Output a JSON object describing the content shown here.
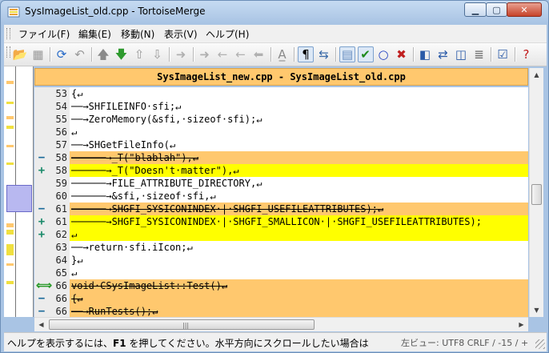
{
  "window": {
    "title": "SysImageList_old.cpp - TortoiseMerge"
  },
  "menu": [
    "ファイル(F)",
    "編集(E)",
    "移動(N)",
    "表示(V)",
    "ヘルプ(H)"
  ],
  "toolbar": [
    {
      "name": "open-icon",
      "glyph": "📂",
      "color": "#d9a21f",
      "pressed": false
    },
    {
      "name": "save-icon",
      "glyph": "▦",
      "color": "#9a9a9a",
      "pressed": false
    },
    {
      "name": "sep"
    },
    {
      "name": "reload-icon",
      "glyph": "⟳",
      "color": "#2a6cc8",
      "pressed": false
    },
    {
      "name": "undo-icon",
      "glyph": "↶",
      "color": "#9a9a9a",
      "pressed": false
    },
    {
      "name": "sep"
    },
    {
      "name": "prev-difference-icon",
      "glyph": "🡅",
      "color": "#8a8a8a",
      "pressed": false
    },
    {
      "name": "next-difference-icon",
      "glyph": "🡇",
      "color": "#2e9a2e",
      "pressed": false
    },
    {
      "name": "prev-conflict-icon",
      "glyph": "⇧",
      "color": "#9a9a9a",
      "pressed": false
    },
    {
      "name": "next-conflict-icon",
      "glyph": "⇩",
      "color": "#9a9a9a",
      "pressed": false
    },
    {
      "name": "sep"
    },
    {
      "name": "use-left-icon",
      "glyph": "➜",
      "color": "#b0b0b0",
      "pressed": false
    },
    {
      "name": "sep"
    },
    {
      "name": "use-block-right-icon",
      "glyph": "➜",
      "color": "#b0b0b0",
      "pressed": false
    },
    {
      "name": "use-block-left-icon",
      "glyph": "←",
      "color": "#b0b0b0",
      "pressed": false
    },
    {
      "name": "use-both-icon",
      "glyph": "←",
      "color": "#b0b0b0",
      "pressed": false
    },
    {
      "name": "use-both-left-icon",
      "glyph": "⬅",
      "color": "#b0b0b0",
      "pressed": false
    },
    {
      "name": "sep"
    },
    {
      "name": "whitespace-icon",
      "glyph": "A̲",
      "color": "#8a8a8a",
      "pressed": false
    },
    {
      "name": "sep"
    },
    {
      "name": "pilcrow-icon",
      "glyph": "¶",
      "color": "#000000",
      "pressed": true
    },
    {
      "name": "wrap-icon",
      "glyph": "⇆",
      "color": "#3a6aa8",
      "pressed": false
    },
    {
      "name": "sep"
    },
    {
      "name": "one-pane-icon",
      "glyph": "▤",
      "color": "#6a8fc0",
      "pressed": true
    },
    {
      "name": "checkmark-icon",
      "glyph": "✔",
      "color": "#1e8a1e",
      "pressed": true
    },
    {
      "name": "circle-icon",
      "glyph": "○",
      "color": "#1f3fc0",
      "pressed": false
    },
    {
      "name": "cross-icon",
      "glyph": "✖",
      "color": "#c02020",
      "pressed": false
    },
    {
      "name": "sep"
    },
    {
      "name": "two-pane-icon",
      "glyph": "◧",
      "color": "#2a5aa8",
      "pressed": false
    },
    {
      "name": "swap-icon",
      "glyph": "⇄",
      "color": "#2a5aa8",
      "pressed": false
    },
    {
      "name": "three-pane-icon",
      "glyph": "◫",
      "color": "#2a5aa8",
      "pressed": false
    },
    {
      "name": "list-icon",
      "glyph": "≣",
      "color": "#666666",
      "pressed": false
    },
    {
      "name": "sep"
    },
    {
      "name": "patch-icon",
      "glyph": "☑",
      "color": "#2a5aa8",
      "pressed": false
    },
    {
      "name": "sep"
    },
    {
      "name": "help-icon",
      "glyph": "?",
      "color": "#c01818",
      "pressed": false
    }
  ],
  "pane": {
    "header": "SysImageList_new.cpp - SysImageList_old.cpp"
  },
  "lines": [
    {
      "num": "53",
      "mark": "",
      "text": "{↵",
      "type": "normal"
    },
    {
      "num": "54",
      "mark": "",
      "text": "──→SHFILEINFO·sfi;↵",
      "type": "normal"
    },
    {
      "num": "55",
      "mark": "",
      "text": "──→ZeroMemory(&sfi,·sizeof·sfi);↵",
      "type": "normal"
    },
    {
      "num": "56",
      "mark": "",
      "text": "↵",
      "type": "normal"
    },
    {
      "num": "57",
      "mark": "",
      "text": "──→SHGetFileInfo(↵",
      "type": "normal"
    },
    {
      "num": "58",
      "mark": "−",
      "text": "──────→_T(\"blablah\"),↵",
      "type": "removed"
    },
    {
      "num": "58",
      "mark": "+",
      "text": "──────→_T(\"Doesn't·matter\"),↵",
      "type": "added"
    },
    {
      "num": "59",
      "mark": "",
      "text": "──────→FILE_ATTRIBUTE_DIRECTORY,↵",
      "type": "normal"
    },
    {
      "num": "60",
      "mark": "",
      "text": "──────→&sfi,·sizeof·sfi,↵",
      "type": "normal"
    },
    {
      "num": "61",
      "mark": "−",
      "text": "──────→SHGFI_SYSICONINDEX·|·SHGFI_USEFILEATTRIBUTES);↵",
      "type": "removed"
    },
    {
      "num": "61",
      "mark": "+",
      "text": "──────→SHGFI_SYSICONINDEX·|·SHGFI_SMALLICON·|·SHGFI_USEFILEATTRIBUTES);",
      "type": "added"
    },
    {
      "num": "62",
      "mark": "+",
      "text": "↵",
      "type": "added"
    },
    {
      "num": "63",
      "mark": "",
      "text": "──→return·sfi.iIcon;↵",
      "type": "normal"
    },
    {
      "num": "64",
      "mark": "",
      "text": "}↵",
      "type": "normal"
    },
    {
      "num": "65",
      "mark": "",
      "text": "↵",
      "type": "normal"
    },
    {
      "num": "66",
      "mark": "⟺",
      "text": "void·CSysImageList::Test()↵",
      "type": "moved"
    },
    {
      "num": "66",
      "mark": "−",
      "text": "{↵",
      "type": "removed"
    },
    {
      "num": "66",
      "mark": "−",
      "text": "──→RunTests();↵",
      "type": "removed"
    }
  ],
  "status": {
    "help_prefix": "ヘルプを表示するには、",
    "help_key": "F1",
    "help_suffix": " を押してください。水平方向にスクロールしたい場合は",
    "view_info": "左ビュー: UTF8 CRLF  / -15 / +"
  },
  "colors": {
    "removed": "#ffc86e",
    "added": "#ffff00",
    "moved": "#ffc86e",
    "mark_removed": "#1a6a9a",
    "mark_added": "#1a8a6a",
    "mark_moved": "#2a9a2a"
  }
}
